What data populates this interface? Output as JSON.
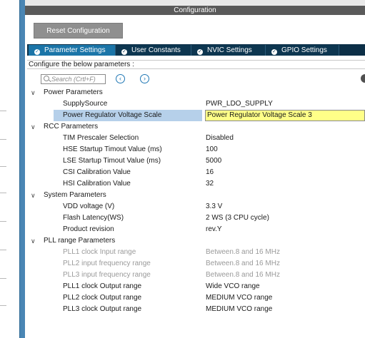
{
  "window": {
    "title": "Configuration"
  },
  "toolbar": {
    "reset_label": "Reset Configuration"
  },
  "tabs": [
    {
      "label": "Parameter Settings",
      "active": true
    },
    {
      "label": "User Constants",
      "active": false
    },
    {
      "label": "NVIC Settings",
      "active": false
    },
    {
      "label": "GPIO Settings",
      "active": false
    }
  ],
  "describe_label": "Configure the below parameters :",
  "search": {
    "placeholder": "Search (Crtl+F)"
  },
  "nav": {
    "prev_icon": "chevron-left-icon",
    "next_icon": "chevron-right-icon"
  },
  "tree": {
    "power": {
      "label": "Power Parameters",
      "items": [
        {
          "name": "SupplySource",
          "value": "PWR_LDO_SUPPLY"
        },
        {
          "name": "Power Regulator Voltage Scale",
          "value": "Power Regulator Voltage Scale 3"
        }
      ]
    },
    "rcc": {
      "label": "RCC Parameters",
      "items": [
        {
          "name": "TIM Prescaler Selection",
          "value": "Disabled"
        },
        {
          "name": "HSE Startup Timout Value (ms)",
          "value": "100"
        },
        {
          "name": "LSE Startup Timout Value (ms)",
          "value": "5000"
        },
        {
          "name": "CSI Calibration Value",
          "value": "16"
        },
        {
          "name": "HSI Calibration Value",
          "value": "32"
        }
      ]
    },
    "system": {
      "label": "System Parameters",
      "items": [
        {
          "name": "VDD voltage (V)",
          "value": "3.3 V"
        },
        {
          "name": "Flash Latency(WS)",
          "value": "2 WS (3 CPU cycle)"
        },
        {
          "name": "Product revision",
          "value": "rev.Y"
        }
      ]
    },
    "pll": {
      "label": "PLL range Parameters",
      "items": [
        {
          "name": "PLL1 clock Input range",
          "value": "Between.8 and 16 MHz"
        },
        {
          "name": "PLL2 input frequency range",
          "value": "Between.8 and 16 MHz"
        },
        {
          "name": "PLL3 input frequency range",
          "value": "Between.8 and 16 MHz"
        },
        {
          "name": "PLL1 clock Output range",
          "value": "Wide VCO range"
        },
        {
          "name": "PLL2 clock Output range",
          "value": "MEDIUM VCO range"
        },
        {
          "name": "PLL3 clock Output range",
          "value": "MEDIUM VCO range"
        }
      ]
    }
  },
  "colors": {
    "selected_row": "#b6d0ea",
    "highlight": "#ffff88",
    "tab_active": "#1b75a8",
    "tab_bar": "#0c2f47"
  }
}
